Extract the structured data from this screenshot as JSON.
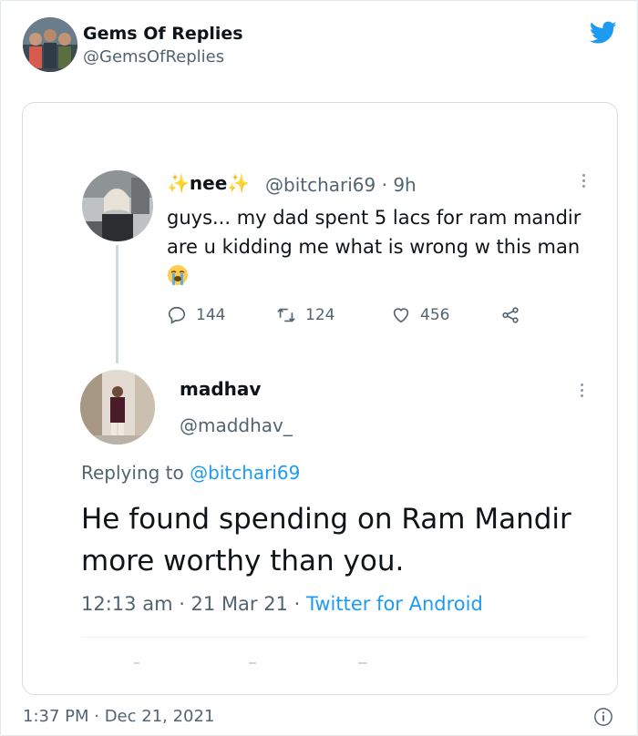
{
  "header": {
    "name": "Gems Of Replies",
    "handle": "@GemsOfReplies",
    "icon": "twitter-bird-icon",
    "brand_color": "#1d9bf0"
  },
  "tweet1": {
    "name": "nee",
    "sparkle_left": "✨",
    "sparkle_right": "✨",
    "meta": "@bitchari69 · 9h",
    "text": "guys... my dad spent 5 lacs for ram mandir are u kidding me what is wrong w this man",
    "emoji": "loudly-crying-face",
    "actions": {
      "replies": "144",
      "retweets": "124",
      "likes": "456"
    }
  },
  "tweet2": {
    "name": "madhav",
    "handle": "@maddhav_",
    "replying_prefix": "Replying to",
    "replying_mention": "@bitchari69",
    "text": "He found spending on Ram Mandir more worthy than you.",
    "meta_time": "12:13 am · 21 Mar 21 · ",
    "meta_source": "Twitter for Android"
  },
  "footer": {
    "timestamp": "1:37 PM · Dec 21, 2021",
    "icon": "info-icon"
  }
}
